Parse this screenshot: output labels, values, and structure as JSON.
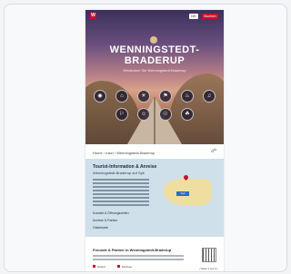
{
  "hero": {
    "title": "WENNINGSTEDT-\nBRADERUP",
    "subtitle": "Entdecken Sie Wenningstedt-Braderup",
    "logo_letter": "W",
    "lang_label": "DE",
    "book_label": "Buchen",
    "nav_icons": [
      "◉",
      "⌂",
      "☀",
      "⚑",
      "♨",
      "♫",
      "⚐",
      "☺",
      "☉",
      "☘"
    ]
  },
  "breadcrumb": "Home  ›  Insel  ›  Wenningstedt-Braderup",
  "info": {
    "title": "Tourist-Information & Anreise",
    "subtitle": "Wenningstedt-Braderup auf Sylt",
    "links": [
      "Kontakt & Öffnungszeiten",
      "Anreise & Parken",
      "Gästekarte"
    ],
    "map_badge": "Sylt"
  },
  "bottom": {
    "title": "Freunde & Partner in Wenningstedt-Braderup",
    "tags": [
      "Strand",
      "Nordsee"
    ],
    "page_nav": "‹ Seite 1 von 3 ›"
  }
}
